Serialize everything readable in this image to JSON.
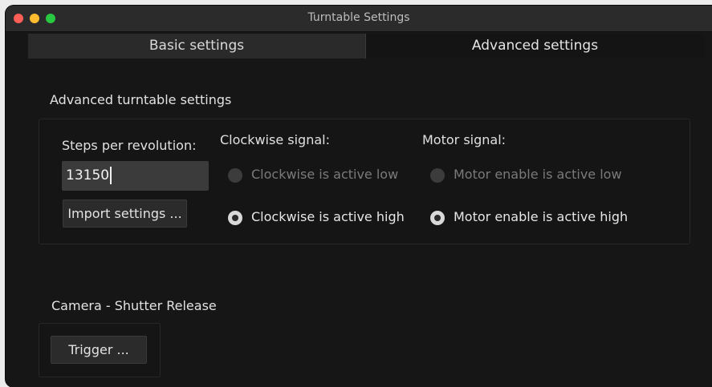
{
  "window": {
    "title": "Turntable Settings"
  },
  "tabs": [
    {
      "label": "Basic settings",
      "active": false
    },
    {
      "label": "Advanced settings",
      "active": true
    }
  ],
  "advanced": {
    "group_title": "Advanced turntable settings",
    "steps_label": "Steps per revolution:",
    "steps_value": "13150",
    "import_button": "Import settings ...",
    "clockwise": {
      "heading": "Clockwise signal:",
      "options": [
        {
          "label": "Clockwise is active low",
          "checked": false,
          "enabled": false
        },
        {
          "label": "Clockwise is active high",
          "checked": true,
          "enabled": true
        }
      ]
    },
    "motor": {
      "heading": "Motor signal:",
      "options": [
        {
          "label": "Motor enable is active low",
          "checked": false,
          "enabled": false
        },
        {
          "label": "Motor enable is active high",
          "checked": true,
          "enabled": true
        }
      ]
    }
  },
  "camera": {
    "group_title": "Camera - Shutter Release",
    "trigger_button": "Trigger ..."
  },
  "colors": {
    "window_bg": "#161616",
    "titlebar_bg": "#2b2b2b",
    "close": "#ff5f57",
    "minimize": "#febc2e",
    "maximize": "#28c840"
  }
}
